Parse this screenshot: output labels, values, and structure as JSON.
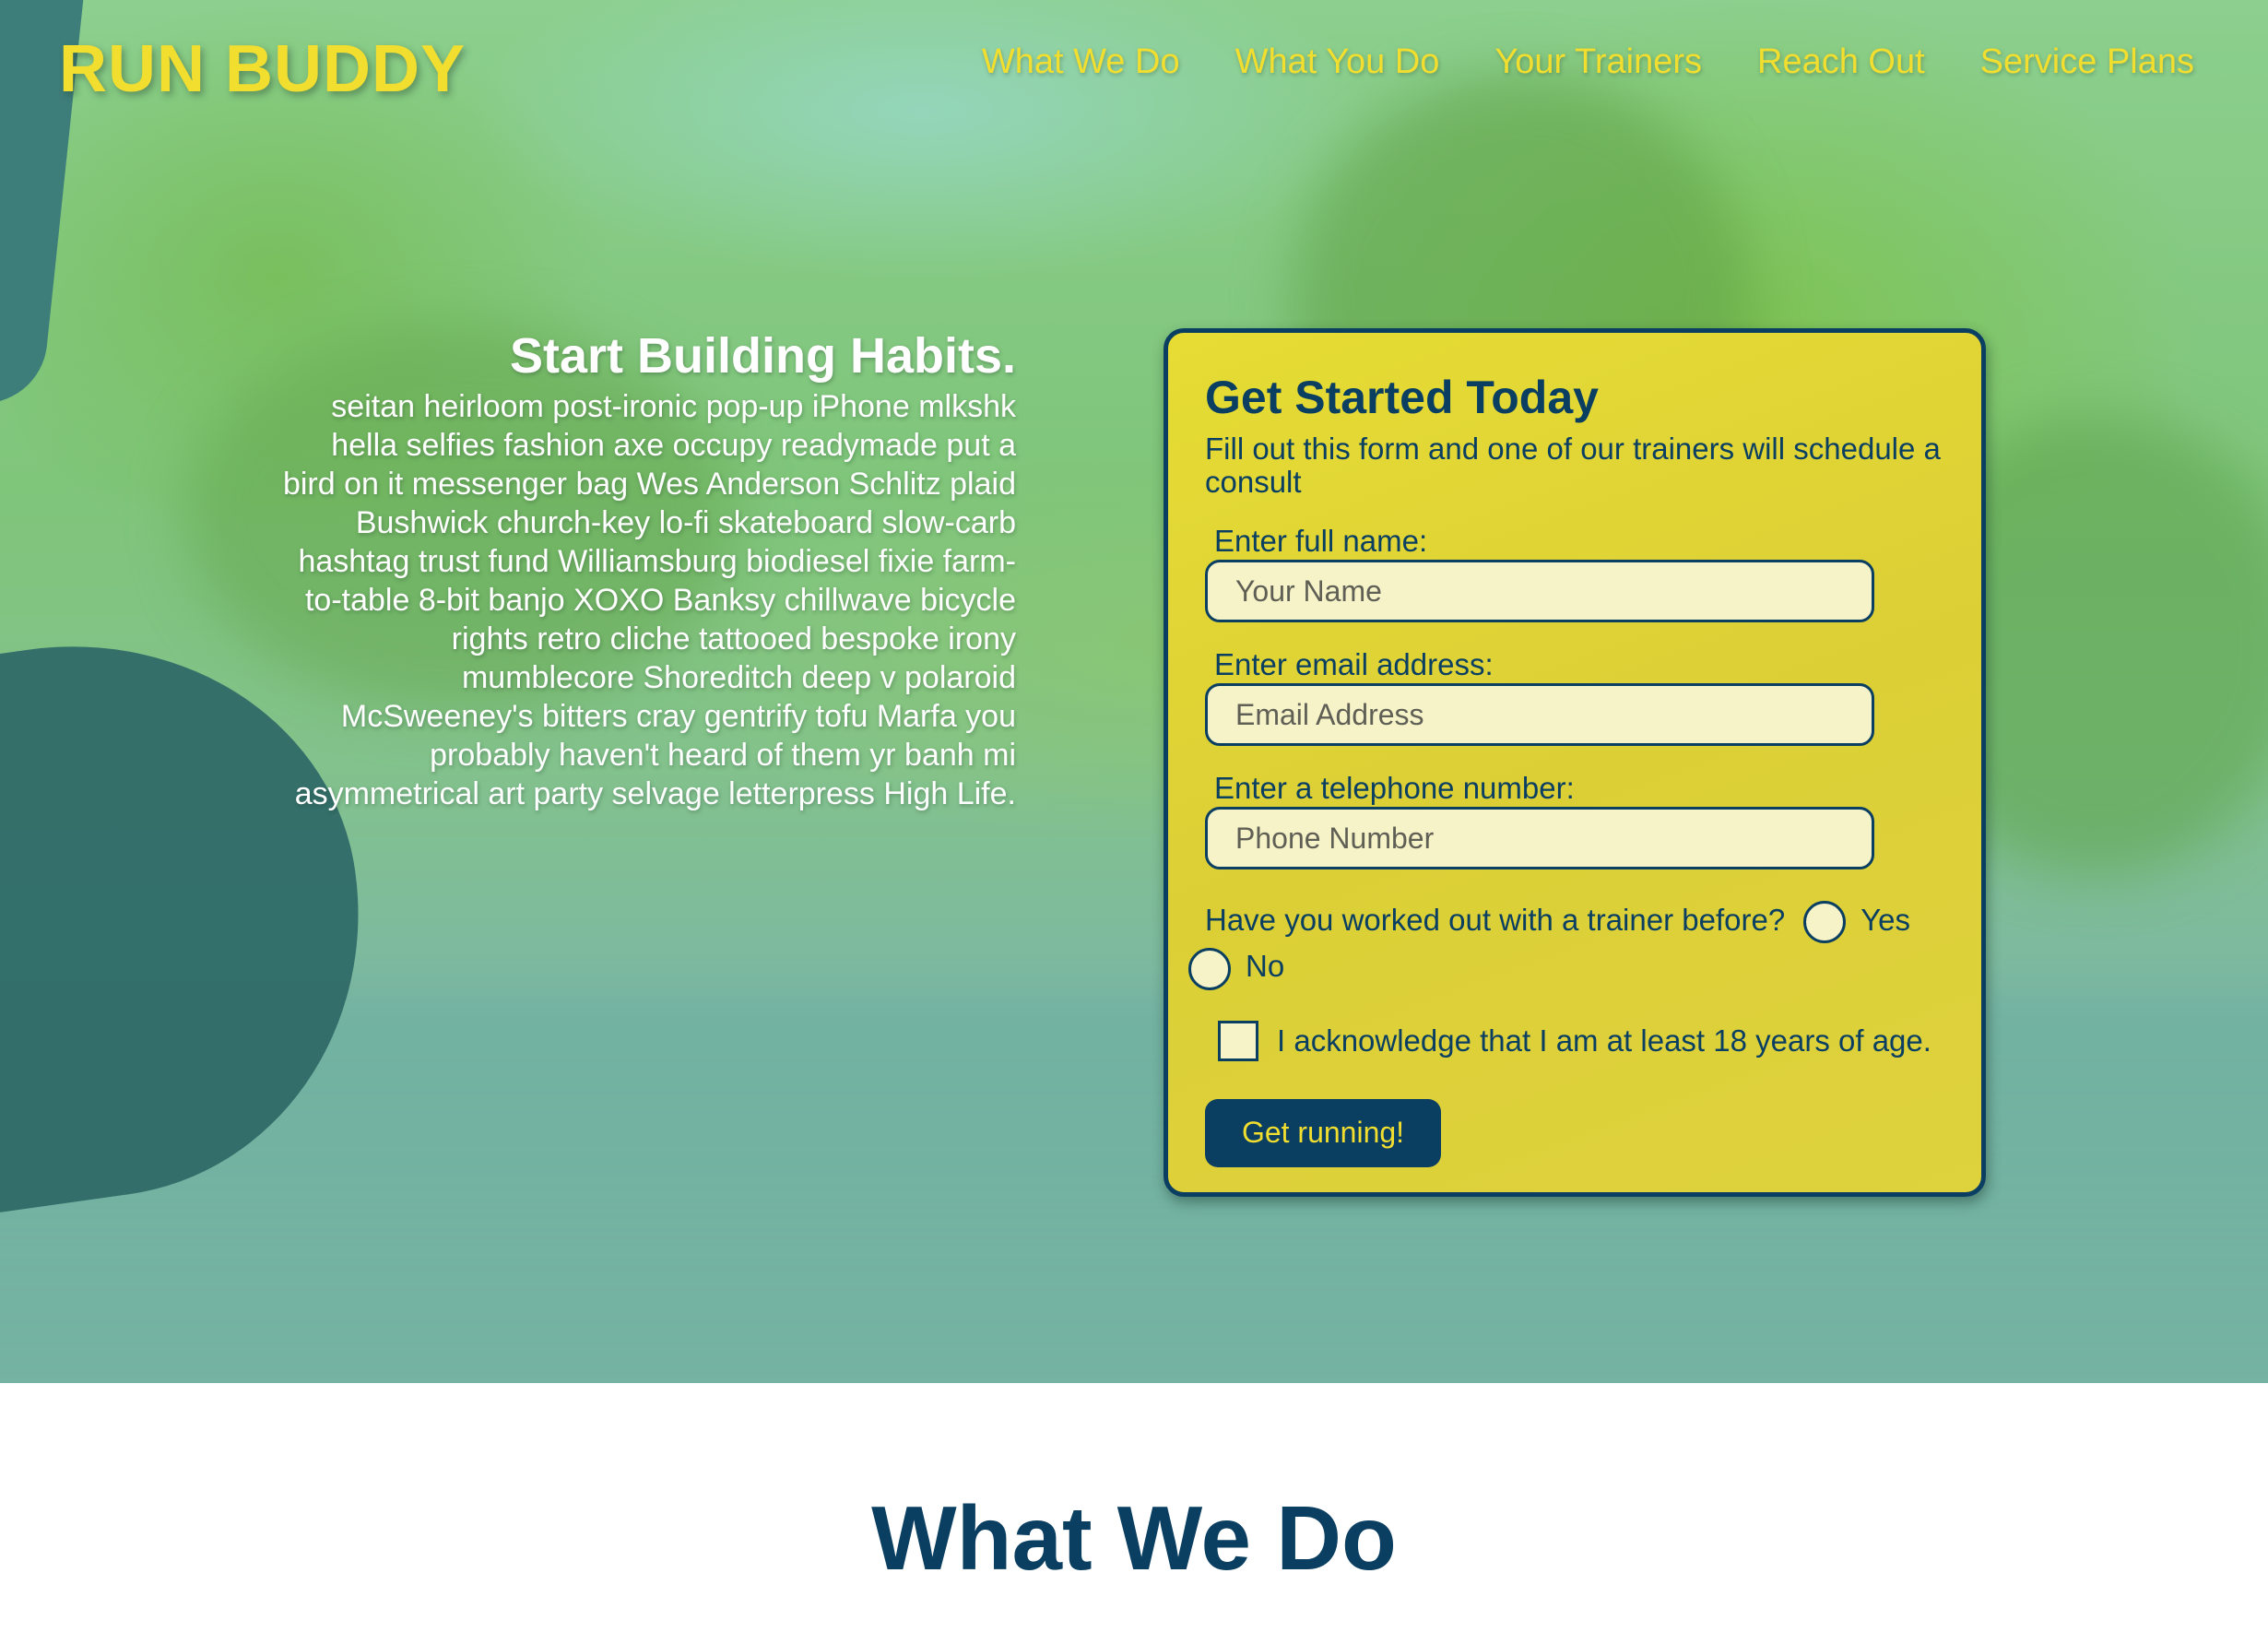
{
  "header": {
    "logo": "RUN BUDDY",
    "nav": [
      "What We Do",
      "What You Do",
      "Your Trainers",
      "Reach Out",
      "Service Plans"
    ]
  },
  "intro": {
    "title": "Start Building Habits.",
    "body": "seitan heirloom post-ironic pop-up iPhone mlkshk hella selfies fashion axe occupy readymade put a bird on it messenger bag Wes Anderson Schlitz plaid Bushwick church-key lo-fi skateboard slow-carb hashtag trust fund Williamsburg biodiesel fixie farm-to-table 8-bit banjo XOXO Banksy chillwave bicycle rights retro cliche tattooed bespoke irony mumblecore Shoreditch deep v polaroid McSweeney's bitters cray gentrify tofu Marfa you probably haven't heard of them yr banh mi asymmetrical art party selvage letterpress High Life."
  },
  "form": {
    "title": "Get Started Today",
    "subtitle": "Fill out this form and one of our trainers will schedule a consult",
    "name_label": "Enter full name:",
    "name_placeholder": "Your Name",
    "email_label": "Enter email address:",
    "email_placeholder": "Email Address",
    "phone_label": "Enter a telephone number:",
    "phone_placeholder": "Phone Number",
    "trainer_question": "Have you worked out with a trainer before?",
    "yes_label": "Yes",
    "no_label": "No",
    "age_ack": "I acknowledge that I am at least 18 years of age.",
    "submit_label": "Get running!"
  },
  "section": {
    "title": "What We Do"
  },
  "colors": {
    "brand_yellow": "#f2de2f",
    "navy": "#0a3f62",
    "form_bg": "#dfd437",
    "input_bg": "#f6f3c8"
  }
}
